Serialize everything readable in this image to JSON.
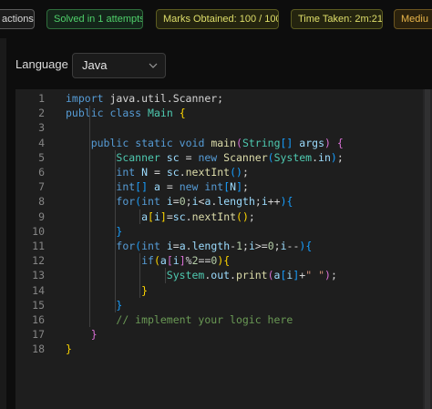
{
  "topbar": {
    "badges": [
      {
        "label": "actions"
      },
      {
        "label": "Solved in 1 attempts"
      },
      {
        "label": "Marks Obtained: 100 / 100"
      },
      {
        "label": "Time Taken: 2m:21s"
      },
      {
        "label": "Mediu"
      }
    ]
  },
  "language": {
    "label": "Language",
    "selected": "Java"
  },
  "editor": {
    "line_numbers": [
      "1",
      "2",
      "3",
      "4",
      "5",
      "6",
      "7",
      "8",
      "9",
      "10",
      "11",
      "12",
      "13",
      "14",
      "15",
      "16",
      "17",
      "18"
    ],
    "lines": [
      [
        [
          "kw",
          "import"
        ],
        [
          "pl",
          " java.util.Scanner;"
        ]
      ],
      [
        [
          "kw",
          "public"
        ],
        [
          "pl",
          " "
        ],
        [
          "kw",
          "class"
        ],
        [
          "pl",
          " "
        ],
        [
          "ty",
          "Main"
        ],
        [
          "pl",
          " "
        ],
        [
          "b1",
          "{"
        ]
      ],
      [],
      [
        [
          "pl",
          "    "
        ],
        [
          "kw",
          "public"
        ],
        [
          "pl",
          " "
        ],
        [
          "kw",
          "static"
        ],
        [
          "pl",
          " "
        ],
        [
          "kw",
          "void"
        ],
        [
          "pl",
          " "
        ],
        [
          "fn",
          "main"
        ],
        [
          "b2",
          "("
        ],
        [
          "ty",
          "String"
        ],
        [
          "b3",
          "[]"
        ],
        [
          "pl",
          " "
        ],
        [
          "vr",
          "args"
        ],
        [
          "b2",
          ")"
        ],
        [
          "pl",
          " "
        ],
        [
          "b2",
          "{"
        ]
      ],
      [
        [
          "pl",
          "        "
        ],
        [
          "ty",
          "Scanner"
        ],
        [
          "pl",
          " "
        ],
        [
          "vr",
          "sc"
        ],
        [
          "pl",
          " = "
        ],
        [
          "kw",
          "new"
        ],
        [
          "pl",
          " "
        ],
        [
          "fn",
          "Scanner"
        ],
        [
          "b3",
          "("
        ],
        [
          "ty",
          "System"
        ],
        [
          "pl",
          "."
        ],
        [
          "vr",
          "in"
        ],
        [
          "b3",
          ")"
        ],
        [
          "pl",
          ";"
        ]
      ],
      [
        [
          "pl",
          "        "
        ],
        [
          "kw",
          "int"
        ],
        [
          "pl",
          " "
        ],
        [
          "vr",
          "N"
        ],
        [
          "pl",
          " = "
        ],
        [
          "vr",
          "sc"
        ],
        [
          "pl",
          "."
        ],
        [
          "fn",
          "nextInt"
        ],
        [
          "b3",
          "()"
        ],
        [
          "pl",
          ";"
        ]
      ],
      [
        [
          "pl",
          "        "
        ],
        [
          "kw",
          "int"
        ],
        [
          "b3",
          "[]"
        ],
        [
          "pl",
          " "
        ],
        [
          "vr",
          "a"
        ],
        [
          "pl",
          " = "
        ],
        [
          "kw",
          "new"
        ],
        [
          "pl",
          " "
        ],
        [
          "kw",
          "int"
        ],
        [
          "b3",
          "["
        ],
        [
          "vr",
          "N"
        ],
        [
          "b3",
          "]"
        ],
        [
          "pl",
          ";"
        ]
      ],
      [
        [
          "pl",
          "        "
        ],
        [
          "kw",
          "for"
        ],
        [
          "b3",
          "("
        ],
        [
          "kw",
          "int"
        ],
        [
          "pl",
          " "
        ],
        [
          "vr",
          "i"
        ],
        [
          "pl",
          "="
        ],
        [
          "nm",
          "0"
        ],
        [
          "pl",
          ";"
        ],
        [
          "vr",
          "i"
        ],
        [
          "pl",
          "<"
        ],
        [
          "vr",
          "a"
        ],
        [
          "pl",
          "."
        ],
        [
          "vr",
          "length"
        ],
        [
          "pl",
          ";"
        ],
        [
          "vr",
          "i"
        ],
        [
          "pl",
          "++"
        ],
        [
          "b3",
          ")"
        ],
        [
          "b3",
          "{"
        ]
      ],
      [
        [
          "pl",
          "            "
        ],
        [
          "vr",
          "a"
        ],
        [
          "b1",
          "["
        ],
        [
          "vr",
          "i"
        ],
        [
          "b1",
          "]"
        ],
        [
          "pl",
          "="
        ],
        [
          "vr",
          "sc"
        ],
        [
          "pl",
          "."
        ],
        [
          "fn",
          "nextInt"
        ],
        [
          "b1",
          "()"
        ],
        [
          "pl",
          ";"
        ]
      ],
      [
        [
          "pl",
          "        "
        ],
        [
          "b3",
          "}"
        ]
      ],
      [
        [
          "pl",
          "        "
        ],
        [
          "kw",
          "for"
        ],
        [
          "b3",
          "("
        ],
        [
          "kw",
          "int"
        ],
        [
          "pl",
          " "
        ],
        [
          "vr",
          "i"
        ],
        [
          "pl",
          "="
        ],
        [
          "vr",
          "a"
        ],
        [
          "pl",
          "."
        ],
        [
          "vr",
          "length"
        ],
        [
          "pl",
          "-"
        ],
        [
          "nm",
          "1"
        ],
        [
          "pl",
          ";"
        ],
        [
          "vr",
          "i"
        ],
        [
          "pl",
          ">="
        ],
        [
          "nm",
          "0"
        ],
        [
          "pl",
          ";"
        ],
        [
          "vr",
          "i"
        ],
        [
          "pl",
          "--"
        ],
        [
          "b3",
          ")"
        ],
        [
          "b3",
          "{"
        ]
      ],
      [
        [
          "pl",
          "            "
        ],
        [
          "kw",
          "if"
        ],
        [
          "b1",
          "("
        ],
        [
          "vr",
          "a"
        ],
        [
          "b2",
          "["
        ],
        [
          "vr",
          "i"
        ],
        [
          "b2",
          "]"
        ],
        [
          "pl",
          "%"
        ],
        [
          "nm",
          "2"
        ],
        [
          "pl",
          "=="
        ],
        [
          "nm",
          "0"
        ],
        [
          "b1",
          ")"
        ],
        [
          "b1",
          "{"
        ]
      ],
      [
        [
          "pl",
          "                "
        ],
        [
          "ty",
          "System"
        ],
        [
          "pl",
          "."
        ],
        [
          "vr",
          "out"
        ],
        [
          "pl",
          "."
        ],
        [
          "fn",
          "print"
        ],
        [
          "b2",
          "("
        ],
        [
          "vr",
          "a"
        ],
        [
          "b3",
          "["
        ],
        [
          "vr",
          "i"
        ],
        [
          "b3",
          "]"
        ],
        [
          "pl",
          "+"
        ],
        [
          "st",
          "\" \""
        ],
        [
          "b2",
          ")"
        ],
        [
          "pl",
          ";"
        ]
      ],
      [
        [
          "pl",
          "            "
        ],
        [
          "b1",
          "}"
        ]
      ],
      [
        [
          "pl",
          "        "
        ],
        [
          "b3",
          "}"
        ]
      ],
      [
        [
          "pl",
          "        "
        ],
        [
          "cm",
          "// implement your logic here"
        ]
      ],
      [
        [
          "pl",
          "    "
        ],
        [
          "b2",
          "}"
        ]
      ],
      [
        [
          "b1",
          "}"
        ]
      ]
    ]
  }
}
